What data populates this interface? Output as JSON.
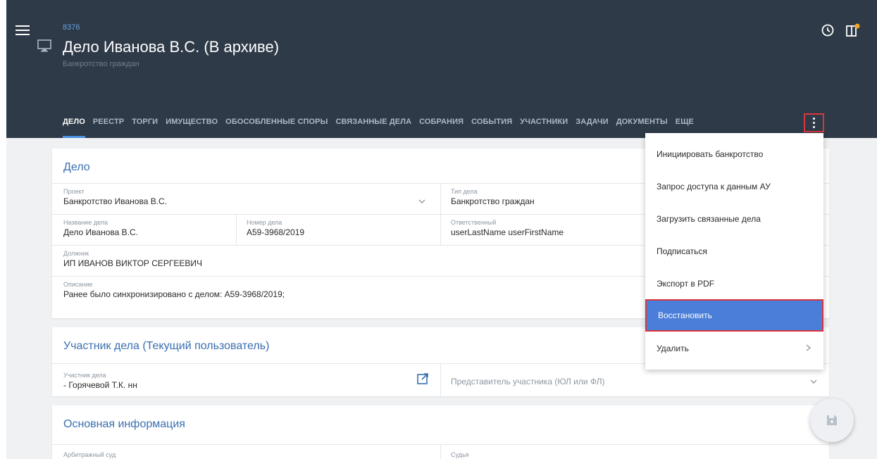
{
  "header": {
    "case_id": "8376",
    "title": "Дело Иванова В.С. (В архиве)",
    "subtitle": "Банкротство граждан"
  },
  "tabs": [
    "ДЕЛО",
    "РЕЕСТР",
    "ТОРГИ",
    "ИМУЩЕСТВО",
    "ОБОСОБЛЕННЫЕ СПОРЫ",
    "СВЯЗАННЫЕ ДЕЛА",
    "СОБРАНИЯ",
    "СОБЫТИЯ",
    "УЧАСТНИКИ",
    "ЗАДАЧИ",
    "ДОКУМЕНТЫ",
    "ЕЩЕ"
  ],
  "case_card": {
    "title": "Дело",
    "project_label": "Проект",
    "project_value": "Банкротство Иванова В.С.",
    "type_label": "Тип дела",
    "type_value": "Банкротство граждан",
    "name_label": "Название дела",
    "name_value": "Дело Иванова В.С.",
    "number_label": "Номер дела",
    "number_value": "А59-3968/2019",
    "responsible_label": "Ответственный",
    "responsible_value": "userLastName userFirstName",
    "debtor_label": "Должник",
    "debtor_value": "ИП ИВАНОВ ВИКТОР СЕРГЕЕВИЧ",
    "desc_label": "Описание",
    "desc_value": "Ранее было синхронизировано с делом: А59-3968/2019;"
  },
  "participant_card": {
    "title": "Участник дела (Текущий пользователь)",
    "participant_label": "Участник дела",
    "participant_value": "- Горячевой Т.К. нн",
    "rep_placeholder": "Представитель участника (ЮЛ или ФЛ)"
  },
  "main_card": {
    "title": "Основная информация",
    "court_label": "Арбитражный суд",
    "judge_label": "Судья"
  },
  "menu": {
    "items": [
      "Инициировать банкротство",
      "Запрос доступа к данным АУ",
      "Загрузить связанные дела",
      "Подписаться",
      "Экспорт в PDF",
      "Восстановить",
      "Удалить"
    ]
  },
  "colors": {
    "header_bg": "#2e3a48",
    "accent": "#4a90e2",
    "highlight_border": "#d9373f",
    "selected_item": "#4a7ed8",
    "notification_dot": "#f5a623"
  }
}
